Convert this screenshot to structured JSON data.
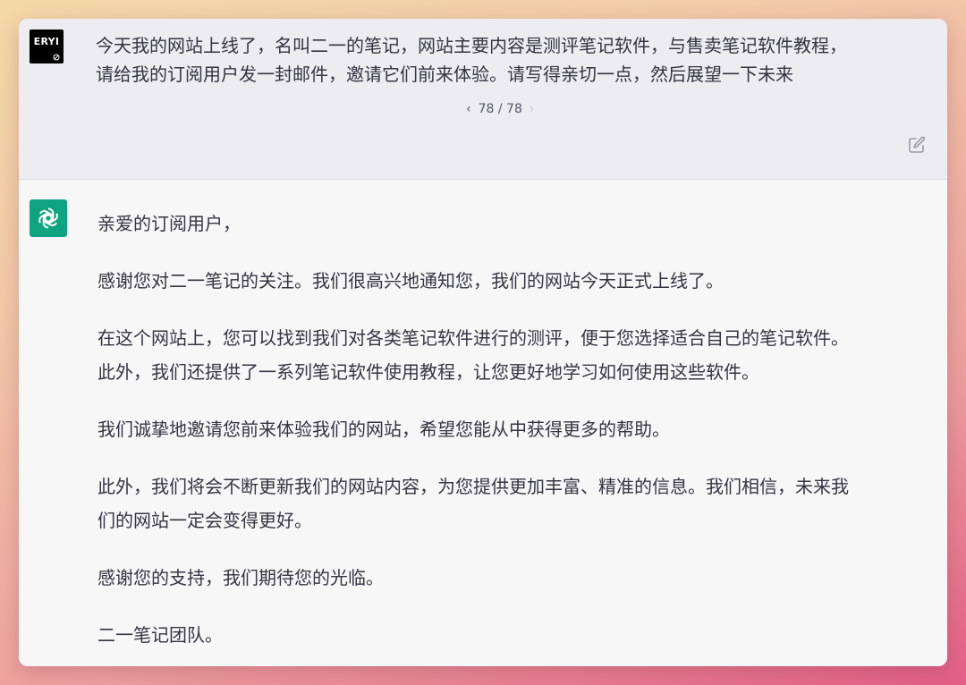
{
  "user": {
    "avatar_text": "ERYI",
    "message_line1": "今天我的网站上线了，名叫二一的笔记，网站主要内容是测评笔记软件，与售卖笔记软件教程，",
    "message_line2": "请给我的订阅用户发一封邮件，邀请它们前来体验。请写得亲切一点，然后展望一下未来",
    "pager": {
      "prev_icon": "chevron-left-icon",
      "label": "78 / 78",
      "next_icon": "chevron-right-icon"
    },
    "edit_icon": "edit-icon"
  },
  "assistant": {
    "avatar_icon": "openai-logo-icon",
    "greeting": "亲爱的订阅用户，",
    "para1": "感谢您对二一笔记的关注。我们很高兴地通知您，我们的网站今天正式上线了。",
    "para2_line1": "在这个网站上，您可以找到我们对各类笔记软件进行的测评，便于您选择适合自己的笔记软件。",
    "para2_line2": "此外，我们还提供了一系列笔记软件使用教程，让您更好地学习如何使用这些软件。",
    "para3": "我们诚挚地邀请您前来体验我们的网站，希望您能从中获得更多的帮助。",
    "para4_line1": "此外，我们将会不断更新我们的网站内容，为您提供更加丰富、精准的信息。我们相信，未来我",
    "para4_line2": "们的网站一定会变得更好。",
    "para5": "感谢您的支持，我们期待您的光临。",
    "signature": "二一笔记团队。"
  },
  "colors": {
    "user_bg": "#ececf1",
    "assistant_bg": "#f7f7f8",
    "ai_avatar": "#10a37f",
    "text": "#343541"
  }
}
